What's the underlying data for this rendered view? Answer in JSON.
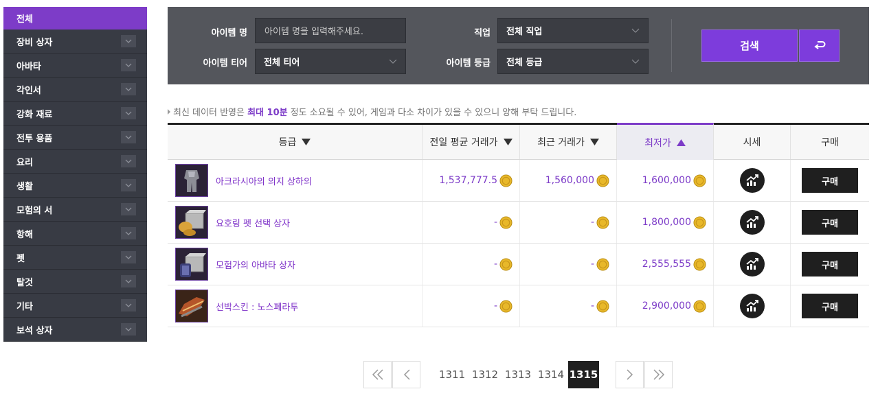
{
  "sidebar": {
    "items": [
      {
        "label": "전체"
      },
      {
        "label": "장비 상자"
      },
      {
        "label": "아바타"
      },
      {
        "label": "각인서"
      },
      {
        "label": "강화 재료"
      },
      {
        "label": "전투 용품"
      },
      {
        "label": "요리"
      },
      {
        "label": "생활"
      },
      {
        "label": "모험의 서"
      },
      {
        "label": "항해"
      },
      {
        "label": "펫"
      },
      {
        "label": "탈것"
      },
      {
        "label": "기타"
      },
      {
        "label": "보석 상자"
      }
    ],
    "active_index": 0
  },
  "search": {
    "item_name_label": "아이템 명",
    "item_name_placeholder": "아이템 명을 입력해주세요.",
    "class_label": "직업",
    "class_value": "전체 직업",
    "tier_label": "아이템 티어",
    "tier_value": "전체 티어",
    "grade_label": "아이템 등급",
    "grade_value": "전체 등급",
    "search_button": "검색"
  },
  "notice": {
    "prefix": "최신 데이터 반영은 ",
    "highlight": "최대 10분",
    "suffix": " 정도 소요될 수 있어, 게임과 다소 차이가 있을 수 있으니 양해 부탁 드립니다."
  },
  "table": {
    "headers": {
      "grade": "등급",
      "avg_price": "전일 평균 거래가",
      "recent_price": "최근 거래가",
      "lowest_price": "최저가",
      "chart": "시세",
      "buy": "구매"
    },
    "sorted_column": "lowest_price",
    "rows": [
      {
        "name": "아크라시아의 의지 상하의",
        "avg": "1,537,777.5",
        "recent": "1,560,000",
        "lowest": "1,600,000",
        "buy": "구매",
        "icon": "armor-icon"
      },
      {
        "name": "요호링 펫 선택 상자",
        "avg": "-",
        "recent": "-",
        "lowest": "1,800,000",
        "buy": "구매",
        "icon": "pet-box-icon"
      },
      {
        "name": "모험가의 아바타 상자",
        "avg": "-",
        "recent": "-",
        "lowest": "2,555,555",
        "buy": "구매",
        "icon": "avatar-box-icon"
      },
      {
        "name": "선박스킨 : 노스페라투",
        "avg": "-",
        "recent": "-",
        "lowest": "2,900,000",
        "buy": "구매",
        "icon": "ship-skin-icon"
      }
    ]
  },
  "pagination": {
    "pages": [
      "1311",
      "1312",
      "1313",
      "1314",
      "1315"
    ],
    "current": "1315"
  },
  "colors": {
    "accent": "#7d3cc8",
    "sidebar_bg": "#383b44",
    "panel_bg": "#54565c"
  }
}
